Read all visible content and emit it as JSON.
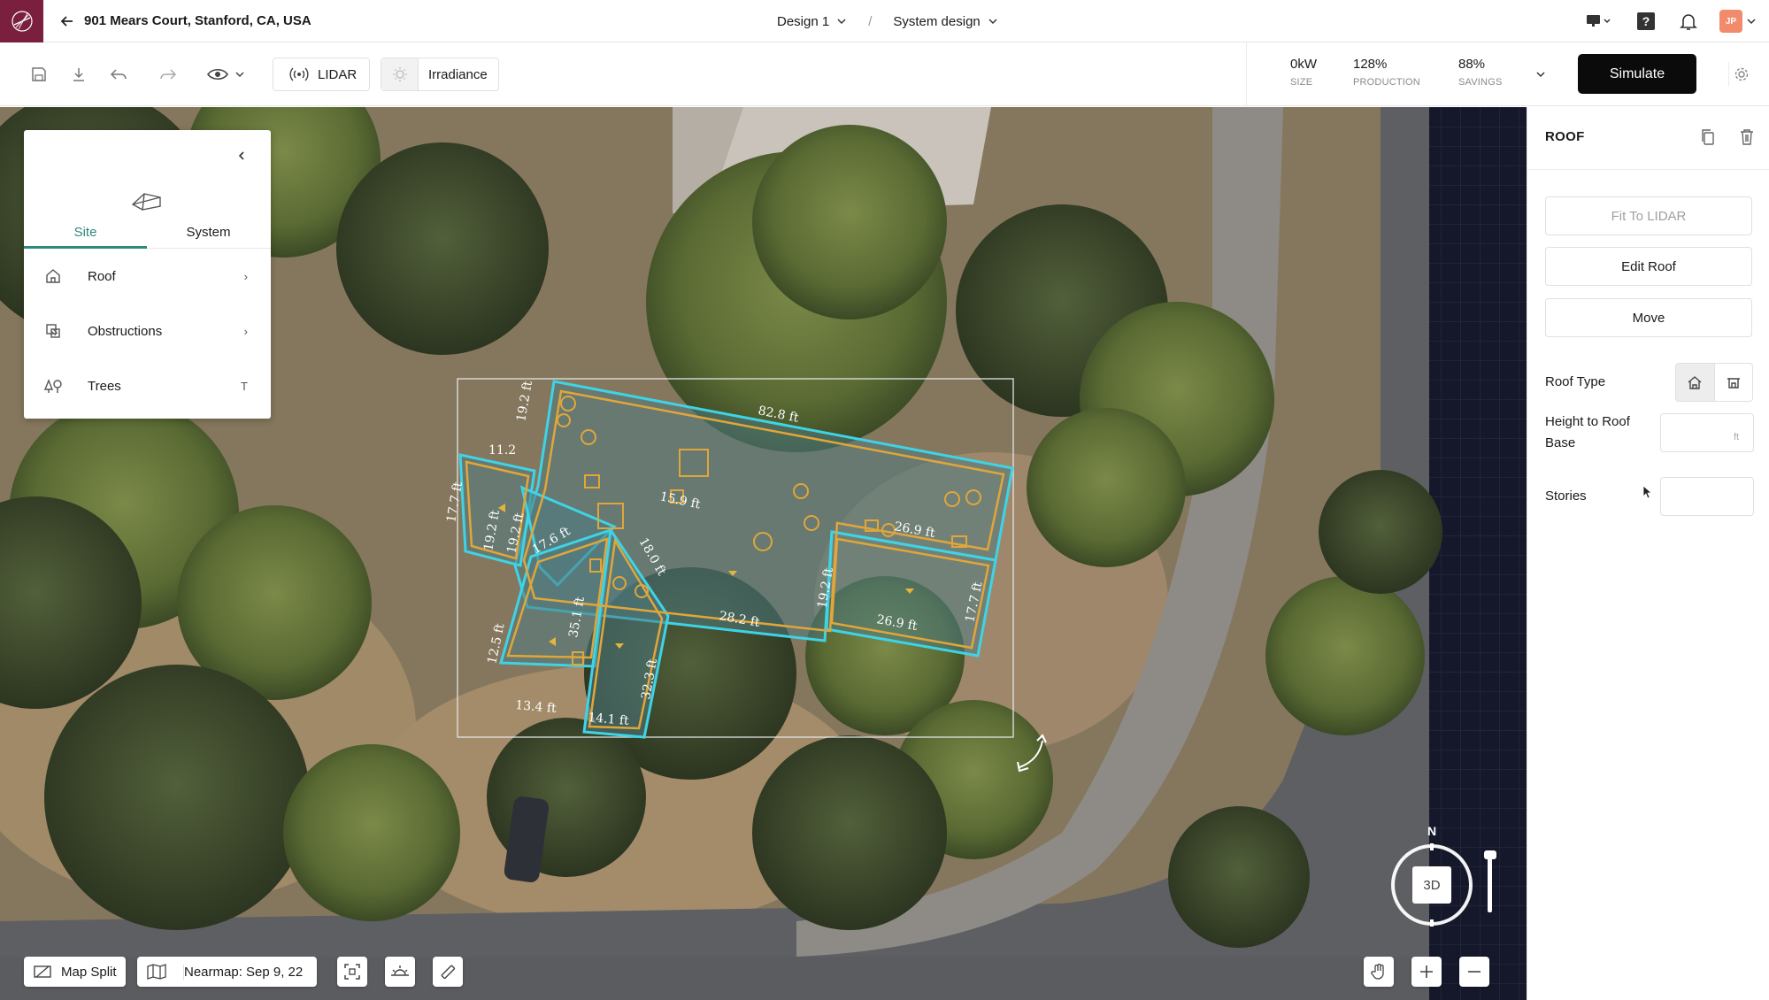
{
  "topbar": {
    "address": "901 Mears Court, Stanford, CA, USA",
    "design": "Design 1",
    "separator": "/",
    "mode": "System design",
    "avatar_initials": "JP"
  },
  "toolbar": {
    "lidar_label": "LIDAR",
    "irradiance_label": "Irradiance",
    "stats": [
      {
        "value": "0kW",
        "label": "SIZE"
      },
      {
        "value": "128%",
        "label": "PRODUCTION"
      },
      {
        "value": "88%",
        "label": "SAVINGS"
      }
    ],
    "simulate_label": "Simulate"
  },
  "left_panel": {
    "tabs": [
      {
        "label": "Site"
      },
      {
        "label": "System"
      }
    ],
    "active_tab": "Site",
    "items": [
      {
        "label": "Roof",
        "end": "›"
      },
      {
        "label": "Obstructions",
        "end": "›"
      },
      {
        "label": "Trees",
        "end": "T"
      }
    ]
  },
  "map": {
    "roof_labels": [
      "82.8 ft",
      "19.2 ft",
      "11.2",
      "17.7 ft",
      "19.2 ft",
      "17.6 ft",
      "15.9 ft",
      "18.0 ft",
      "28.2 ft",
      "19.2 ft",
      "26.9 ft",
      "26.9 ft",
      "17.7 ft",
      "12.5 ft",
      "35.1 ft",
      "13.4 ft",
      "14.1 ft",
      "32.3 ft",
      "19.2 ft"
    ],
    "map_split_label": "Map Split",
    "imagery_label": "Nearmap: Sep 9, 22",
    "compass_north": "N",
    "compass_mode": "3D"
  },
  "right_panel": {
    "title": "ROOF",
    "fit_lidar": "Fit To LIDAR",
    "edit_roof": "Edit Roof",
    "move": "Move",
    "roof_type_label": "Roof Type",
    "height_label_1": "Height to Roof",
    "height_label_2": "Base",
    "height_unit": "ft",
    "stories_label": "Stories",
    "height_value": "",
    "stories_value": ""
  },
  "colors": {
    "brand": "#7a1f3d",
    "roof_outline": "#3fd3e6",
    "segment_outline": "#e0a63a",
    "active_tab": "#2e8a7a",
    "simulate_bg": "#0b0b0b"
  }
}
